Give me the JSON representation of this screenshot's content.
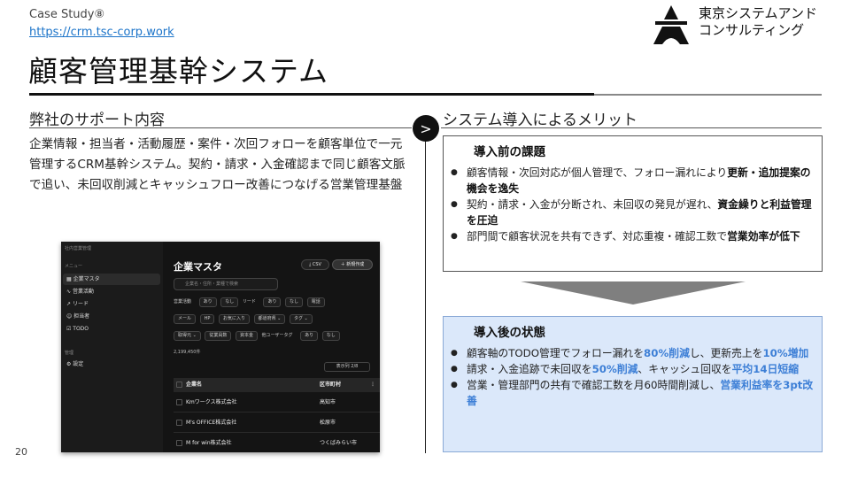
{
  "header": {
    "case_label": "Case Study⑧",
    "url": "https://crm.tsc-corp.work",
    "title": "顧客管理基幹システム"
  },
  "logo": {
    "line1": "東京システムアンド",
    "line2": "コンサルティング"
  },
  "left": {
    "heading": "弊社のサポート内容",
    "body": "企業情報・担当者・活動履歴・案件・次回フォローを顧客単位で一元管理するCRM基幹システム。契約・請求・入金確認まで同じ顧客文脈で追い、未回収削減とキャッシュフロー改善につなげる営業管理基盤"
  },
  "right": {
    "heading": "システム導入によるメリット",
    "arrow": ">",
    "before": {
      "heading": "導入前の課題",
      "items": [
        {
          "text": "顧客情報・次回対応が個人管理で、フォロー漏れにより",
          "bold": "更新・追加提案の機会を逸失",
          "tail": ""
        },
        {
          "text": "契約・請求・入金が分断され、未回収の発見が遅れ、",
          "bold": "資金繰りと利益管理を圧迫",
          "tail": ""
        },
        {
          "text": "部門間で顧客状況を共有できず、対応重複・確認工数で",
          "bold": "営業効率が低下",
          "tail": ""
        }
      ]
    },
    "after": {
      "heading": "導入後の状態",
      "items": [
        {
          "a": "顧客軸のTODO管理でフォロー漏れを",
          "b1": "80%削減",
          "c": "し、更新売上を",
          "b2": "10%増加",
          "d": ""
        },
        {
          "a": "請求・入金追跡で未回収を",
          "b1": "50%削減",
          "c": "、キャッシュ回収を",
          "b2": "平均14日短縮",
          "d": ""
        },
        {
          "a": "営業・管理部門の共有で確認工数を月60時間削減し、",
          "b1": "営業利益率を3pt改善",
          "c": "",
          "b2": "",
          "d": ""
        }
      ]
    }
  },
  "screenshot": {
    "app_label": "社内営業管理",
    "menu_label": "メニュー",
    "sidebar_items": [
      "企業マスタ",
      "営業活動",
      "リード",
      "担当者",
      "TODO"
    ],
    "mgmt_label": "管理",
    "settings_label": "設定",
    "page_title": "企業マスタ",
    "csv_label": "CSV",
    "new_label": "＋ 新規作成",
    "search_placeholder": "企業名・住所・業種で検索",
    "filters_row1": [
      "営業活動",
      "あり",
      "なし",
      "リード",
      "あり",
      "なし",
      "電話"
    ],
    "filters_row2": [
      "メール",
      "HP",
      "お気に入り",
      "都道府県 ⌄",
      "タグ ⌄"
    ],
    "filters_row3": [
      "取得元 ⌄",
      "従業員数",
      "資本金",
      "他ユーザータグ",
      "あり",
      "なし"
    ],
    "count": "2,199,450件",
    "columns_button": "表示列 2/8",
    "col_name": "企業名",
    "col_city": "区市町村",
    "rows": [
      {
        "name": "Kmワークス株式会社",
        "city": "高知市"
      },
      {
        "name": "M's OFFICE株式会社",
        "city": "松原市"
      },
      {
        "name": "M for win株式会社",
        "city": "つくばみらい市"
      }
    ]
  },
  "page_number": "20"
}
